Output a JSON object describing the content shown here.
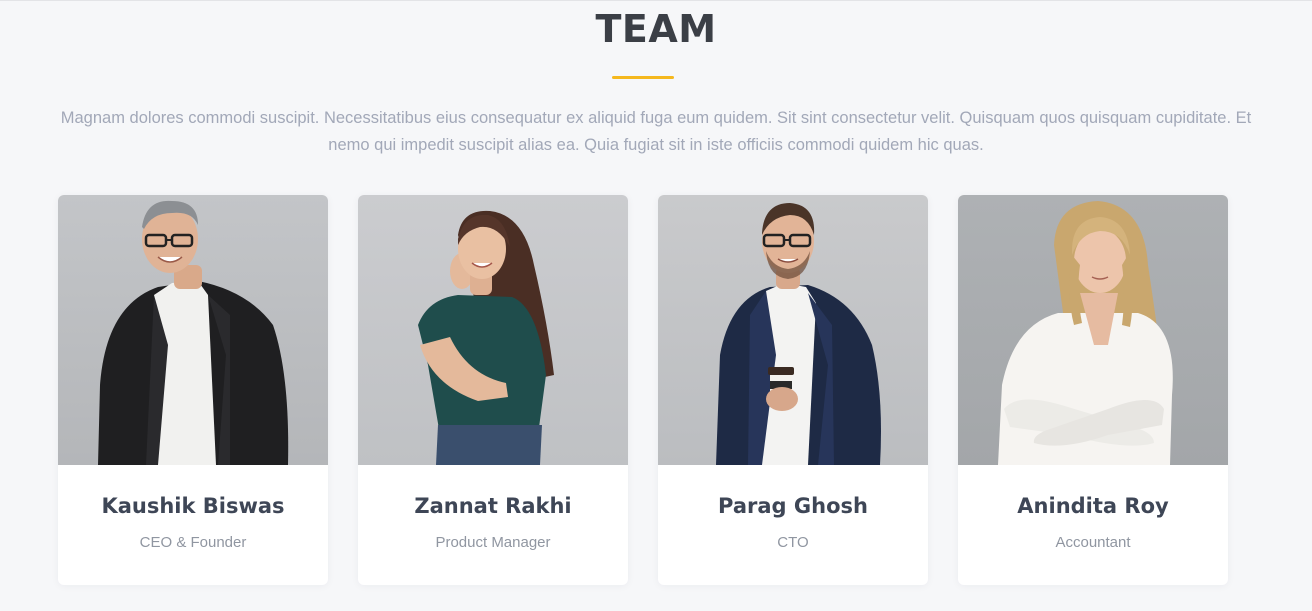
{
  "section": {
    "title": "TEAM",
    "accent_color": "#f5b81e",
    "intro": "Magnam dolores commodi suscipit. Necessitatibus eius consequatur ex aliquid fuga eum quidem. Sit sint consectetur velit. Quisquam quos quisquam cupiditate. Et nemo qui impedit suscipit alias ea. Quia fugiat sit in iste officiis commodi quidem hic quas."
  },
  "team": [
    {
      "name": "Kaushik Biswas",
      "role": "CEO & Founder"
    },
    {
      "name": "Zannat Rakhi",
      "role": "Product Manager"
    },
    {
      "name": "Parag Ghosh",
      "role": "CTO"
    },
    {
      "name": "Anindita Roy",
      "role": "Accountant"
    }
  ]
}
